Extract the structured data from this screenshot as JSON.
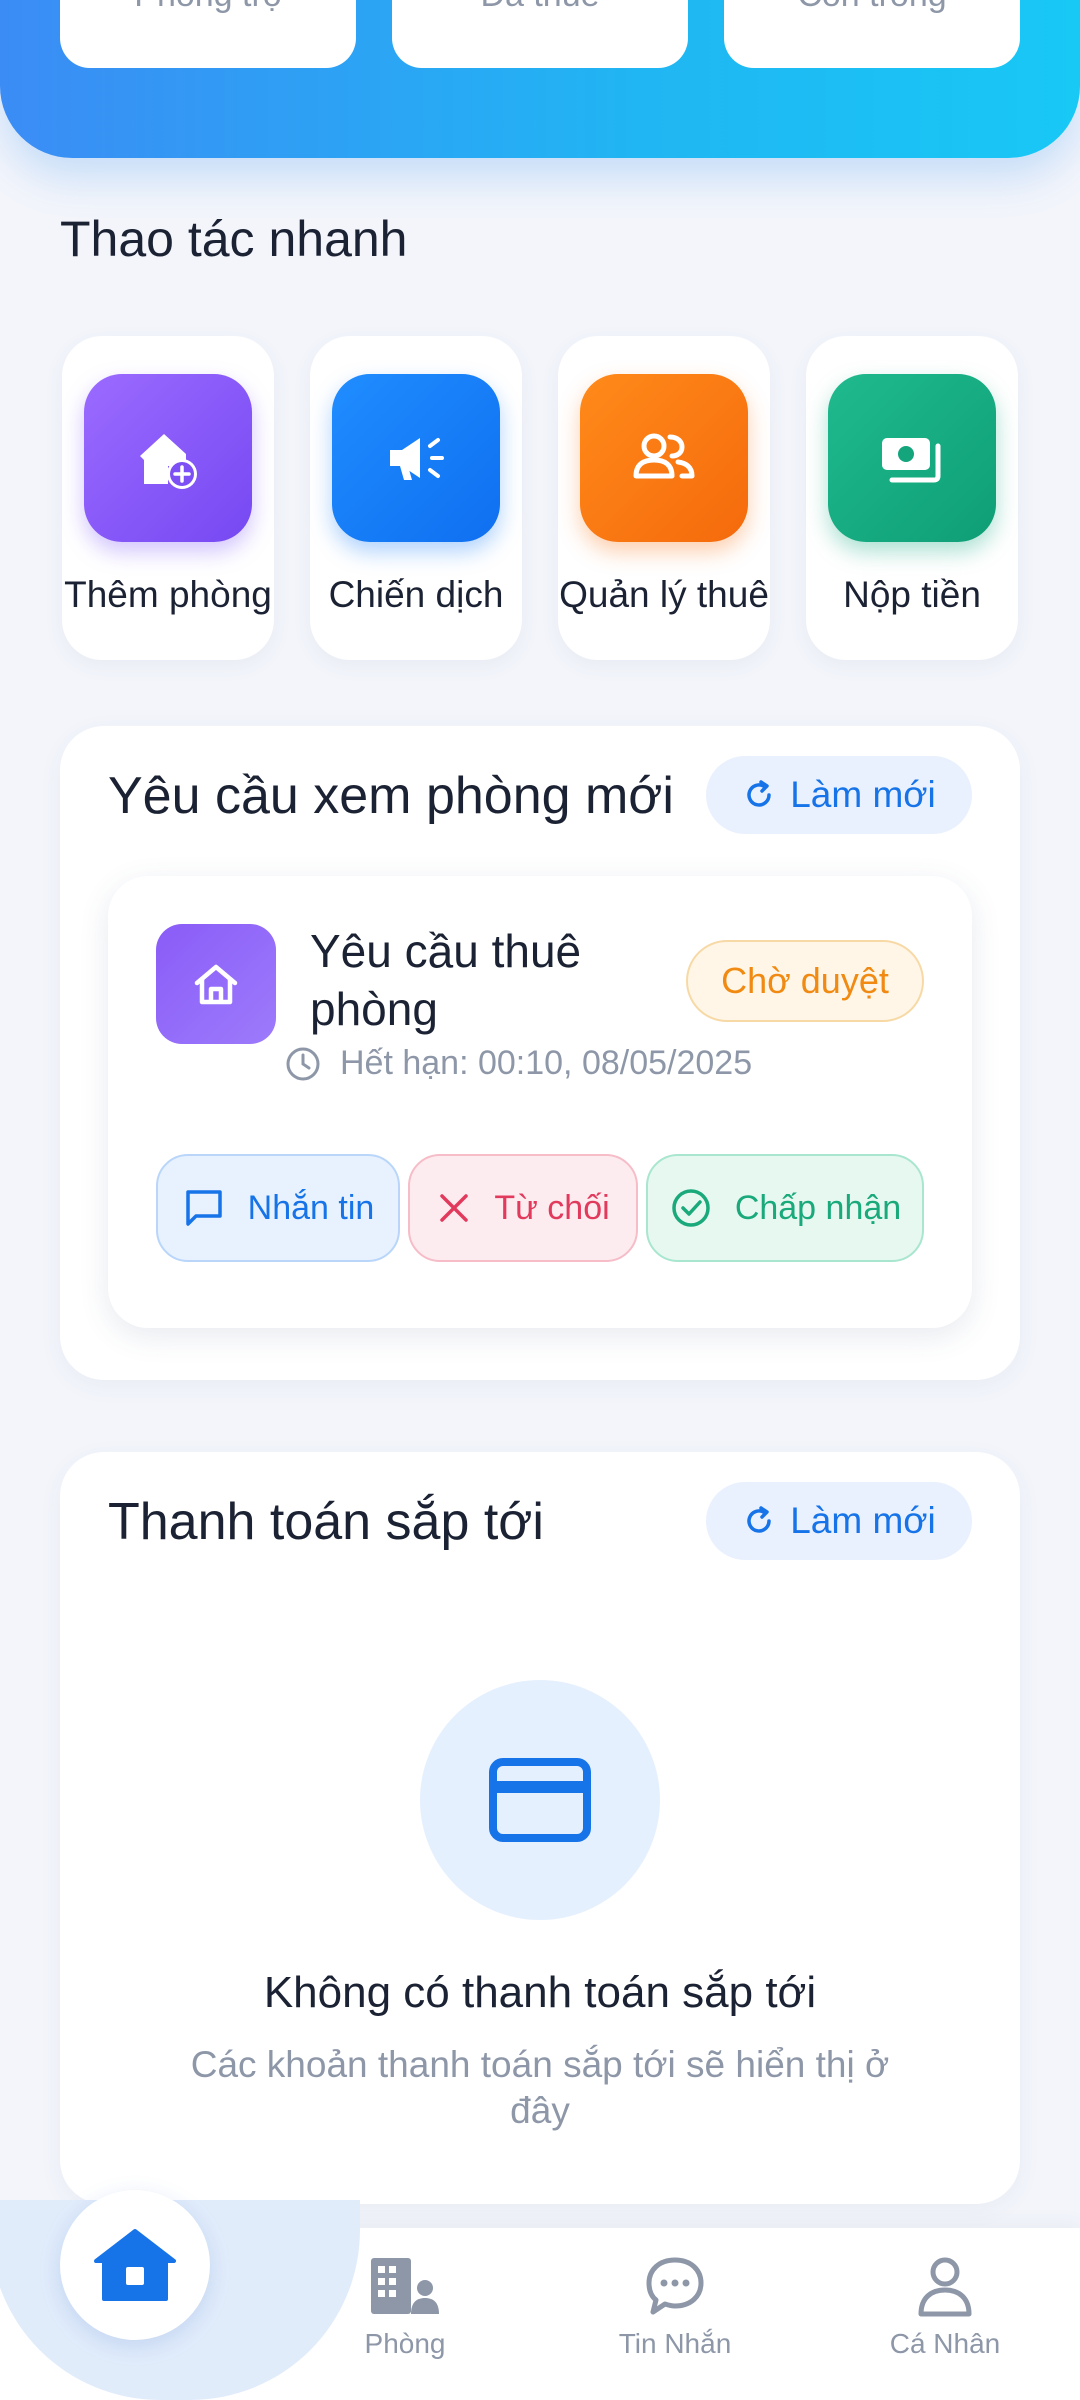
{
  "stats": {
    "items": [
      {
        "label": "Phòng trọ"
      },
      {
        "label": "Đã thuê"
      },
      {
        "label": "Còn trống"
      }
    ]
  },
  "quick_actions": {
    "title": "Thao tác nhanh",
    "items": [
      {
        "label": "Thêm phòng",
        "icon": "add-home-icon",
        "color": "#8a5cf8"
      },
      {
        "label": "Chiến dịch",
        "icon": "megaphone-icon",
        "color": "#1d86fb"
      },
      {
        "label": "Quản lý thuê",
        "icon": "users-icon",
        "color": "#fb7d14"
      },
      {
        "label": "Nộp tiền",
        "icon": "money-icon",
        "color": "#17ae84"
      }
    ]
  },
  "requests": {
    "title": "Yêu cầu xem phòng mới",
    "refresh_label": "Làm mới",
    "item": {
      "title": "Yêu cầu thuê phòng",
      "status": "Chờ duyệt",
      "expire": "Hết hạn: 00:10, 08/05/2025",
      "actions": {
        "message": "Nhắn tin",
        "reject": "Từ chối",
        "accept": "Chấp nhận"
      }
    }
  },
  "payments": {
    "title": "Thanh toán sắp tới",
    "refresh_label": "Làm mới",
    "empty_title": "Không có thanh toán sắp tới",
    "empty_desc": "Các khoản thanh toán sắp tới sẽ hiển thị ở đây"
  },
  "bottom_nav": {
    "items": [
      {
        "label": "",
        "icon": "home-icon",
        "active": true
      },
      {
        "label": "Phòng",
        "icon": "building-icon"
      },
      {
        "label": "Tin Nhắn",
        "icon": "chat-icon"
      },
      {
        "label": "Cá Nhân",
        "icon": "person-icon"
      }
    ]
  },
  "colors": {
    "accent": "#1773e8",
    "banner_start": "#3b8cf5",
    "banner_end": "#18c8f5",
    "pending": "#f08a12",
    "reject": "#e23a5c",
    "accept": "#19a97a"
  }
}
